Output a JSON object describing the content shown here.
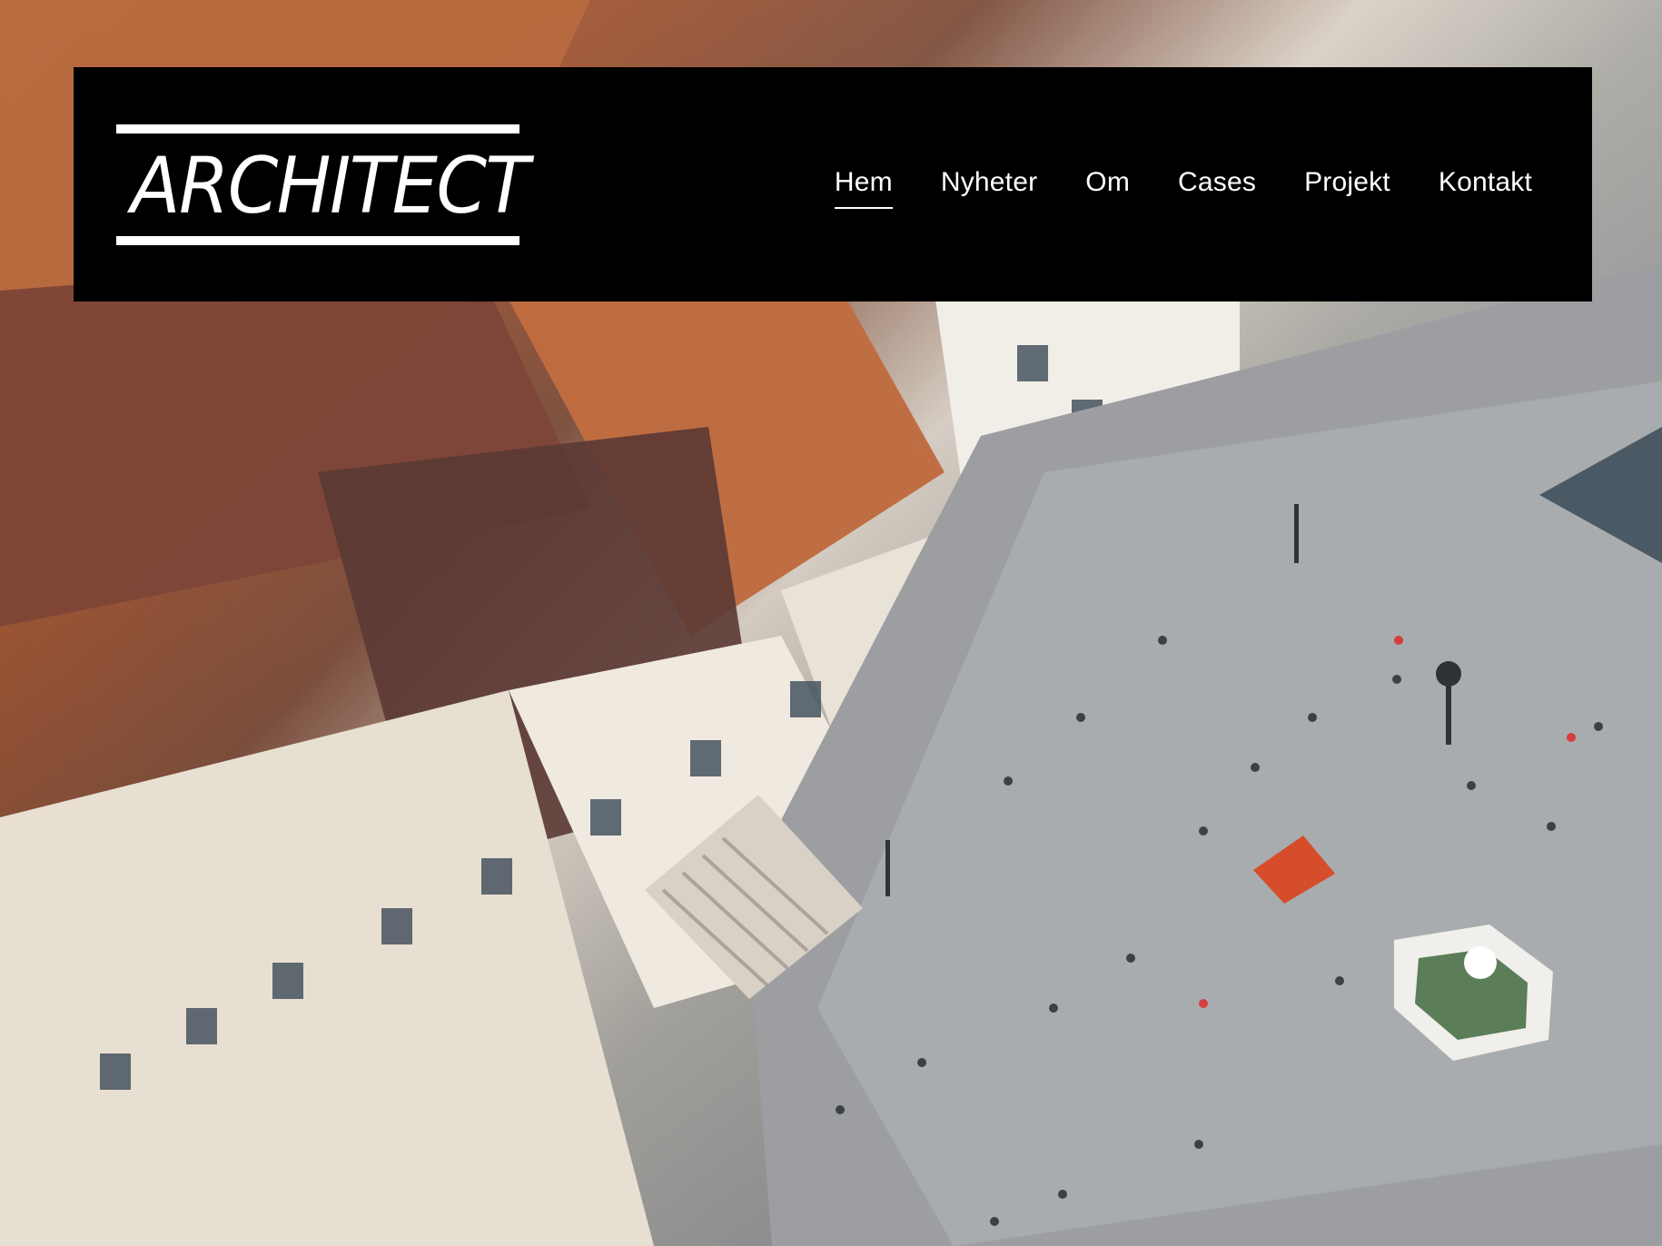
{
  "brand": {
    "logo_text": "ARCHITECT"
  },
  "nav": {
    "items": [
      {
        "label": "Hem",
        "active": true
      },
      {
        "label": "Nyheter",
        "active": false
      },
      {
        "label": "Om",
        "active": false
      },
      {
        "label": "Cases",
        "active": false
      },
      {
        "label": "Projekt",
        "active": false
      },
      {
        "label": "Kontakt",
        "active": false
      }
    ]
  },
  "colors": {
    "header_bg": "#000000",
    "header_text": "#ffffff"
  }
}
